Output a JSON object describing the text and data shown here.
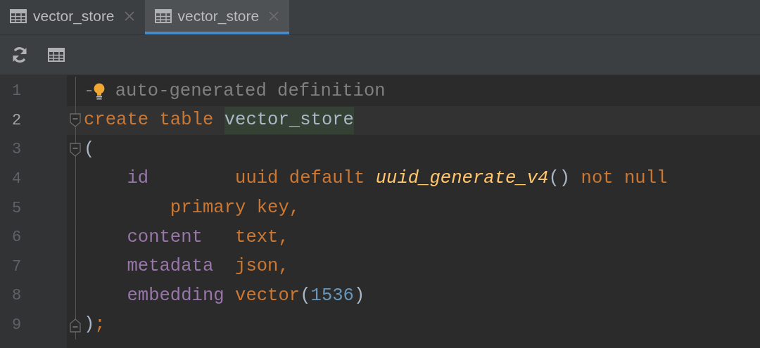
{
  "tabs": [
    {
      "label": "vector_store",
      "selected": false
    },
    {
      "label": "vector_store",
      "selected": true
    }
  ],
  "editor": {
    "lines": [
      {
        "number": "1",
        "current": false,
        "kind": "plain",
        "tokens": [
          {
            "kind": "comment",
            "text": "-"
          },
          {
            "kind": "bulb"
          },
          {
            "kind": "comment",
            "text": " auto-generated definition"
          }
        ]
      },
      {
        "number": "2",
        "current": true,
        "kind": "fold_start",
        "tokens": [
          {
            "kind": "keyword",
            "text": "create table "
          },
          {
            "kind": "highlight",
            "text": "vector_store"
          }
        ]
      },
      {
        "number": "3",
        "current": false,
        "kind": "fold_start",
        "tokens": [
          {
            "kind": "punct",
            "text": "("
          }
        ]
      },
      {
        "number": "4",
        "current": false,
        "kind": "plain",
        "tokens": [
          {
            "kind": "column",
            "text": "    id        "
          },
          {
            "kind": "keyword",
            "text": "uuid default "
          },
          {
            "kind": "func",
            "text": "uuid_generate_v4"
          },
          {
            "kind": "punct",
            "text": "()"
          },
          {
            "kind": "keyword",
            "text": " not null"
          }
        ]
      },
      {
        "number": "5",
        "current": false,
        "kind": "plain",
        "tokens": [
          {
            "kind": "keyword",
            "text": "        primary key,"
          }
        ]
      },
      {
        "number": "6",
        "current": false,
        "kind": "plain",
        "tokens": [
          {
            "kind": "column",
            "text": "    content   "
          },
          {
            "kind": "keyword",
            "text": "text,"
          }
        ]
      },
      {
        "number": "7",
        "current": false,
        "kind": "plain",
        "tokens": [
          {
            "kind": "column",
            "text": "    metadata  "
          },
          {
            "kind": "keyword",
            "text": "json,"
          }
        ]
      },
      {
        "number": "8",
        "current": false,
        "kind": "plain",
        "tokens": [
          {
            "kind": "column",
            "text": "    embedding "
          },
          {
            "kind": "keyword",
            "text": "vector"
          },
          {
            "kind": "punct",
            "text": "("
          },
          {
            "kind": "number",
            "text": "1536"
          },
          {
            "kind": "punct",
            "text": ")"
          }
        ]
      },
      {
        "number": "9",
        "current": false,
        "kind": "fold_end",
        "tokens": [
          {
            "kind": "punct",
            "text": ")"
          },
          {
            "kind": "keyword",
            "text": ";"
          }
        ]
      }
    ]
  }
}
